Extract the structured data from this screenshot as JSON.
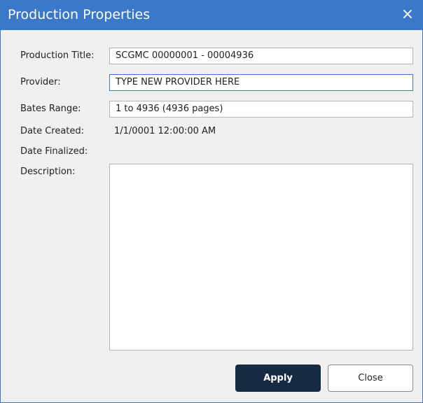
{
  "window": {
    "title": "Production Properties",
    "close_icon": "×"
  },
  "fields": {
    "production_title_label": "Production Title:",
    "production_title_value": "SCGMC 00000001 - 00004936",
    "provider_label": "Provider:",
    "provider_value": "TYPE NEW PROVIDER HERE",
    "bates_range_label": "Bates Range:",
    "bates_range_value": "1 to 4936 (4936 pages)",
    "date_created_label": "Date Created:",
    "date_created_value": "1/1/0001 12:00:00 AM",
    "date_finalized_label": "Date Finalized:",
    "date_finalized_value": "",
    "description_label": "Description:",
    "description_value": ""
  },
  "buttons": {
    "apply_label": "Apply",
    "close_label": "Close"
  },
  "colors": {
    "titlebar": "#3a78c9",
    "apply_bg": "#172a44",
    "dialog_bg": "#f0f0f0"
  }
}
